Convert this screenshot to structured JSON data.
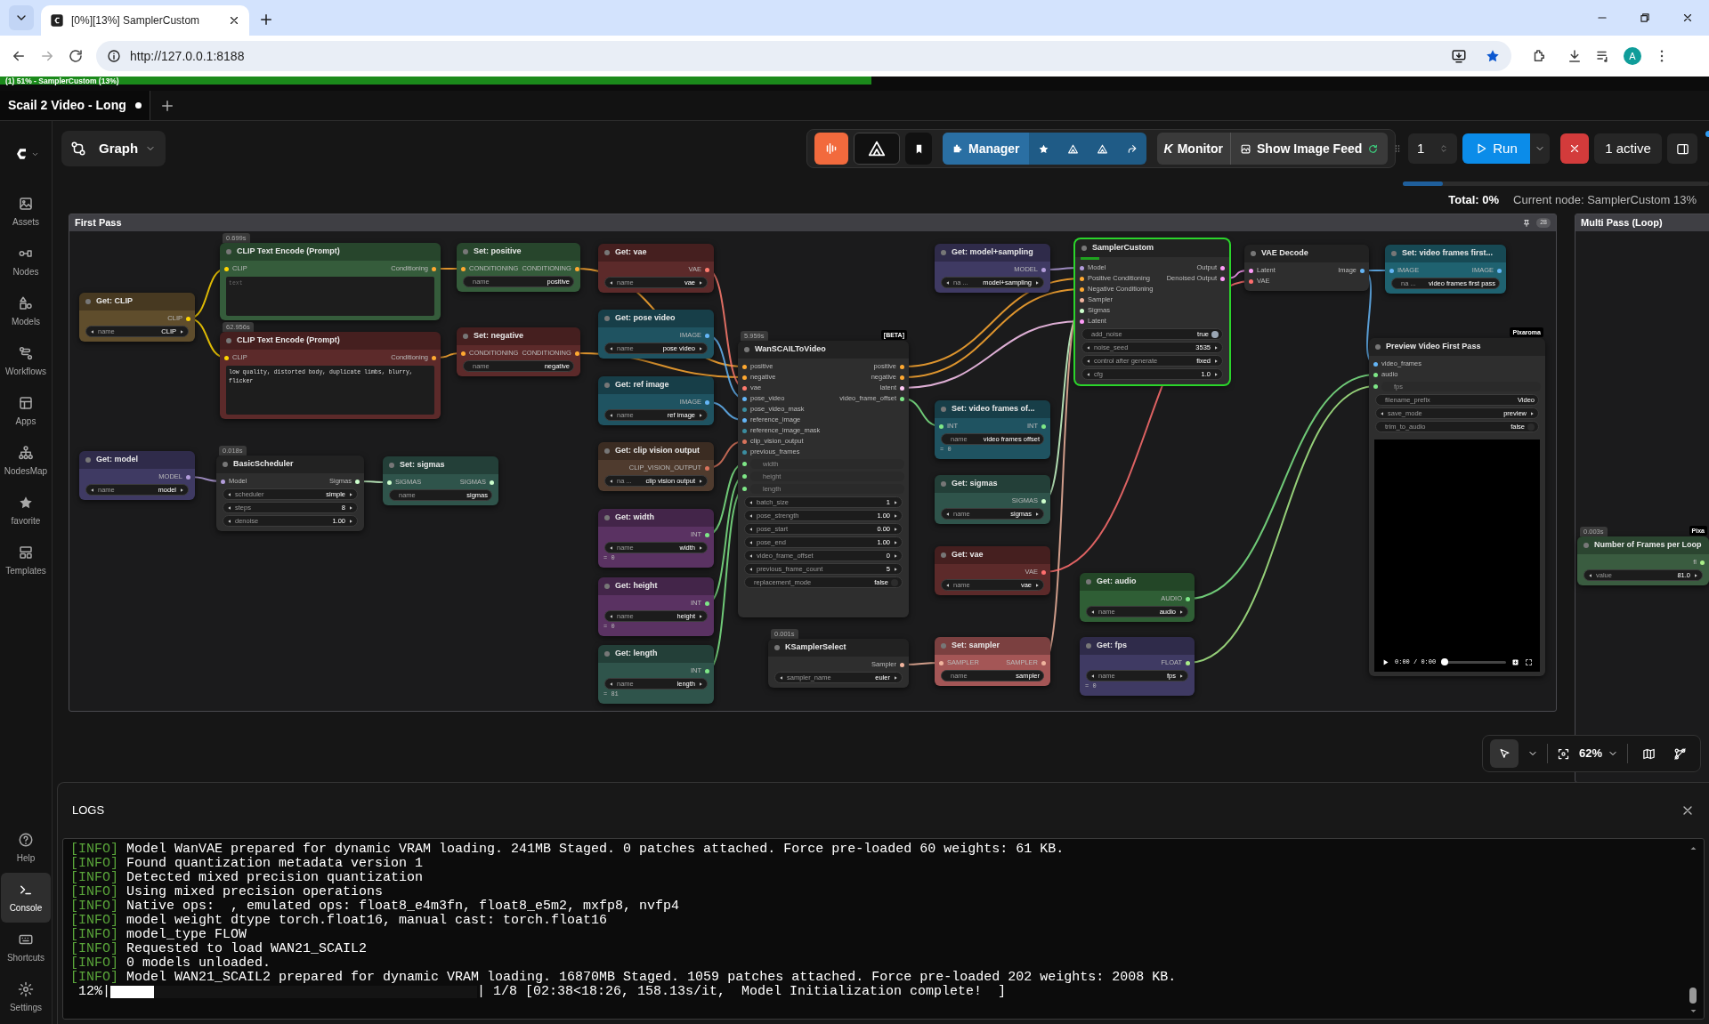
{
  "browser": {
    "tabs": [
      {
        "title": "[0%][13%] SamplerCustom",
        "selected": true
      }
    ],
    "url": "http://127.0.0.1:8188",
    "profile_initial": "A"
  },
  "progress": {
    "text": "(1) 51% - SamplerCustom (13%)",
    "level": 0.51
  },
  "workflow_tabs": [
    {
      "label": "Scail 2 Video - Long",
      "selected": true,
      "unsaved": true
    }
  ],
  "sidebar": {
    "top": [
      {
        "label": "Assets",
        "selected": false
      },
      {
        "label": "Nodes",
        "selected": false
      },
      {
        "label": "Models",
        "selected": false
      },
      {
        "label": "Workflows",
        "selected": false
      },
      {
        "label": "Apps",
        "selected": false
      },
      {
        "label": "NodesMap",
        "selected": false
      },
      {
        "label": "favorite",
        "selected": false
      },
      {
        "label": "Templates",
        "selected": false
      }
    ],
    "bottom": [
      {
        "label": "Help",
        "selected": false
      },
      {
        "label": "Console",
        "selected": true
      },
      {
        "label": "Shortcuts",
        "selected": false
      },
      {
        "label": "Settings",
        "selected": false
      }
    ]
  },
  "toolbar": {
    "graph": "Graph",
    "manager": "Manager",
    "monitor_logo": "K",
    "monitor": "Monitor",
    "image_feed": "Show Image Feed",
    "batch_count": "1",
    "run": "Run",
    "queue": "1 active"
  },
  "status": {
    "total": "Total: 0%",
    "current_node": "Current node: SamplerCustom 13%",
    "level": 0.13
  },
  "groups": [
    {
      "title": "First Pass",
      "badge": "28"
    },
    {
      "title": "Multi Pass (Loop)"
    }
  ],
  "nodes": [
    {
      "title": "Get: CLIP",
      "color": "#5f4d2c",
      "executing": false,
      "outputs": [
        {
          "label": "CLIP",
          "color": "#ffd500"
        }
      ],
      "widgets": [
        {
          "kind": "combo",
          "label": "name",
          "value": "CLIP"
        }
      ]
    },
    {
      "title": "CLIP Text Encode (Prompt)",
      "color": "#355c3b",
      "executing": false,
      "timing": "0.699s",
      "inputs": [
        {
          "label": "CLIP",
          "color": "#ffd500"
        }
      ],
      "outputs": [
        {
          "label": "Conditioning",
          "color": "#ffa931"
        }
      ],
      "prompt": {
        "placeholder": "text"
      }
    },
    {
      "title": "CLIP Text Encode (Prompt)",
      "color": "#5c2a2a",
      "executing": false,
      "timing": "62.956s",
      "inputs": [
        {
          "label": "CLIP",
          "color": "#ffd500"
        }
      ],
      "outputs": [
        {
          "label": "Conditioning",
          "color": "#ffa931"
        }
      ],
      "prompt": {
        "value": "low quality, distorted body, duplicate limbs, blurry, flicker"
      }
    },
    {
      "title": "Set: positive",
      "color": "#355c3b",
      "executing": false,
      "inputs": [
        {
          "label": "CONDITIONING",
          "color": "#ffa931"
        }
      ],
      "outputs": [
        {
          "label": "CONDITIONING",
          "color": "#ffa931"
        }
      ],
      "widgets": [
        {
          "kind": "text",
          "label": "name",
          "value": "positive"
        }
      ]
    },
    {
      "title": "Set: negative",
      "color": "#5c2a2a",
      "executing": false,
      "inputs": [
        {
          "label": "CONDITIONING",
          "color": "#ffa931"
        }
      ],
      "outputs": [
        {
          "label": "CONDITIONING",
          "color": "#ffa931"
        }
      ],
      "widgets": [
        {
          "kind": "text",
          "label": "name",
          "value": "negative"
        }
      ]
    },
    {
      "title": "Get: model",
      "color": "#3f3a63",
      "executing": false,
      "outputs": [
        {
          "label": "MODEL",
          "color": "#b39ddb"
        }
      ],
      "widgets": [
        {
          "kind": "combo",
          "label": "name",
          "value": "model"
        }
      ]
    },
    {
      "title": "BasicScheduler",
      "color": "#2e2e2e",
      "executing": false,
      "timing": "0.018s",
      "inputs": [
        {
          "label": "Model",
          "color": "#b39ddb"
        }
      ],
      "outputs": [
        {
          "label": "Sigmas",
          "color": "#cdffcd"
        }
      ],
      "widgets": [
        {
          "kind": "combo",
          "label": "scheduler",
          "value": "simple"
        },
        {
          "kind": "number",
          "label": "steps",
          "value": "8"
        },
        {
          "kind": "number",
          "label": "denoise",
          "value": "1.00"
        }
      ]
    },
    {
      "title": "Set: sigmas",
      "color": "#2f544b",
      "executing": false,
      "inputs": [
        {
          "label": "SIGMAS",
          "color": "#cdffcd"
        }
      ],
      "outputs": [
        {
          "label": "SIGMAS",
          "color": "#cdffcd"
        }
      ],
      "widgets": [
        {
          "kind": "text",
          "label": "name",
          "value": "sigmas"
        }
      ]
    },
    {
      "title": "Get: vae",
      "color": "#5c2a2a",
      "executing": false,
      "outputs": [
        {
          "label": "VAE",
          "color": "#ff7b6e"
        }
      ],
      "widgets": [
        {
          "kind": "combo",
          "label": "name",
          "value": "vae"
        }
      ]
    },
    {
      "title": "Get: pose video",
      "color": "#1f5361",
      "executing": false,
      "outputs": [
        {
          "label": "IMAGE",
          "color": "#64b5f6"
        }
      ],
      "widgets": [
        {
          "kind": "combo",
          "label": "name",
          "value": "pose video"
        }
      ]
    },
    {
      "title": "Get: ref image",
      "color": "#1f5361",
      "executing": false,
      "outputs": [
        {
          "label": "IMAGE",
          "color": "#64b5f6"
        }
      ],
      "widgets": [
        {
          "kind": "combo",
          "label": "name",
          "value": "ref image"
        }
      ]
    },
    {
      "title": "Get: clip vision output",
      "color": "#4f3b2e",
      "executing": false,
      "outputs": [
        {
          "label": "CLIP_VISION_OUTPUT",
          "color": "#d9735c"
        }
      ],
      "widgets": [
        {
          "kind": "combo",
          "label": "na ...",
          "value": "clip vision output"
        }
      ]
    },
    {
      "title": "Get: width",
      "color": "#5a3262",
      "executing": false,
      "outputs": [
        {
          "label": "INT",
          "color": "#7ee787"
        }
      ],
      "widgets": [
        {
          "kind": "combo",
          "label": "name",
          "value": "width"
        }
      ],
      "note": "= 0"
    },
    {
      "title": "Get: height",
      "color": "#5a3262",
      "executing": false,
      "outputs": [
        {
          "label": "INT",
          "color": "#7ee787"
        }
      ],
      "widgets": [
        {
          "kind": "combo",
          "label": "name",
          "value": "height"
        }
      ],
      "note": "= 0"
    },
    {
      "title": "Get: length",
      "color": "#2f544b",
      "executing": false,
      "outputs": [
        {
          "label": "INT",
          "color": "#7ee787"
        }
      ],
      "widgets": [
        {
          "kind": "combo",
          "label": "name",
          "value": "length"
        }
      ],
      "note": "= 81"
    },
    {
      "title": "WanSCAILToVideo",
      "color": "#2e2e2e",
      "executing": false,
      "timing": "5.959s",
      "tag": "[BETA]",
      "inputs": [
        {
          "label": "positive",
          "color": "#ffa931"
        },
        {
          "label": "negative",
          "color": "#ffa931"
        },
        {
          "label": "vae",
          "color": "#ff7b6e"
        },
        {
          "label": "pose_video",
          "color": "#64b5f6"
        },
        {
          "label": "pose_video_mask",
          "color": "#3b8da0"
        },
        {
          "label": "reference_image",
          "color": "#64b5f6"
        },
        {
          "label": "reference_image_mask",
          "color": "#3b8da0"
        },
        {
          "label": "clip_vision_output",
          "color": "#d9735c"
        },
        {
          "label": "previous_frames",
          "color": "#3b8da0"
        },
        {
          "label": "width",
          "color": "#7ee787",
          "kind": "widget"
        },
        {
          "label": "height",
          "color": "#7ee787",
          "kind": "widget"
        },
        {
          "label": "length",
          "color": "#7ee787",
          "kind": "widget"
        }
      ],
      "outputs": [
        {
          "label": "positive",
          "color": "#ffa931"
        },
        {
          "label": "negative",
          "color": "#ffa931"
        },
        {
          "label": "latent",
          "color": "#ffc8f5"
        },
        {
          "label": "video_frame_offset",
          "color": "#7ee787"
        }
      ],
      "widgets": [
        {
          "kind": "number",
          "label": "batch_size",
          "value": "1"
        },
        {
          "kind": "number",
          "label": "pose_strength",
          "value": "1.00"
        },
        {
          "kind": "number",
          "label": "pose_start",
          "value": "0.00"
        },
        {
          "kind": "number",
          "label": "pose_end",
          "value": "1.00"
        },
        {
          "kind": "number",
          "label": "video_frame_offset",
          "value": "0"
        },
        {
          "kind": "number",
          "label": "previous_frame_count",
          "value": "5"
        },
        {
          "kind": "toggle",
          "label": "replacement_mode",
          "value": "false",
          "on": false
        }
      ]
    },
    {
      "title": "KSamplerSelect",
      "color": "#2e2e2e",
      "executing": false,
      "timing": "0.001s",
      "outputs": [
        {
          "label": "Sampler",
          "color": "#f0b49e"
        }
      ],
      "widgets": [
        {
          "kind": "combo",
          "label": "sampler_name",
          "value": "euler"
        }
      ]
    },
    {
      "title": "Get: model+sampling",
      "color": "#3f3a63",
      "executing": false,
      "outputs": [
        {
          "label": "MODEL",
          "color": "#b39ddb"
        }
      ],
      "widgets": [
        {
          "kind": "combo",
          "label": "na ...",
          "value": "model+sampling"
        }
      ]
    },
    {
      "title": "Set: video frames of...",
      "color": "#1f5361",
      "executing": false,
      "inputs": [
        {
          "label": "INT",
          "color": "#7ee787"
        }
      ],
      "outputs": [
        {
          "label": "INT",
          "color": "#7ee787"
        }
      ],
      "widgets": [
        {
          "kind": "text",
          "label": "name",
          "value": "video frames offset"
        }
      ],
      "note": "= 0"
    },
    {
      "title": "Get: sigmas",
      "color": "#2f544b",
      "executing": false,
      "outputs": [
        {
          "label": "SIGMAS",
          "color": "#cdffcd"
        }
      ],
      "widgets": [
        {
          "kind": "combo",
          "label": "name",
          "value": "sigmas"
        }
      ]
    },
    {
      "title": "Get: vae",
      "color": "#5c2a2a",
      "executing": false,
      "outputs": [
        {
          "label": "VAE",
          "color": "#ff6e6e"
        }
      ],
      "widgets": [
        {
          "kind": "combo",
          "label": "name",
          "value": "vae"
        }
      ]
    },
    {
      "title": "Set: sampler",
      "color": "#a45656",
      "executing": false,
      "inputs": [
        {
          "label": "SAMPLER",
          "color": "#f0b49e"
        }
      ],
      "outputs": [
        {
          "label": "SAMPLER",
          "color": "#f0b49e"
        }
      ],
      "widgets": [
        {
          "kind": "text",
          "label": "name",
          "value": "sampler"
        }
      ]
    },
    {
      "title": "SamplerCustom",
      "color": "#2e2e2e",
      "executing": true,
      "level": 0.13,
      "inputs": [
        {
          "label": "Model",
          "color": "#b39ddb"
        },
        {
          "label": "Positive Conditioning",
          "color": "#ffa931"
        },
        {
          "label": "Negative Conditioning",
          "color": "#ffa931"
        },
        {
          "label": "Sampler",
          "color": "#f0b49e"
        },
        {
          "label": "Sigmas",
          "color": "#cdffcd"
        },
        {
          "label": "Latent",
          "color": "#ff9cf9"
        }
      ],
      "outputs": [
        {
          "label": "Output",
          "color": "#ff9cf9"
        },
        {
          "label": "Denoised Output",
          "color": "#ff9cf9"
        }
      ],
      "widgets": [
        {
          "kind": "toggle",
          "label": "add_noise",
          "value": "true",
          "on": true
        },
        {
          "kind": "number",
          "label": "noise_seed",
          "value": "3535"
        },
        {
          "kind": "combo",
          "label": "control after generate",
          "value": "fixed"
        },
        {
          "kind": "number",
          "label": "cfg",
          "value": "1.0"
        }
      ]
    },
    {
      "title": "VAE Decode",
      "color": "#2e2e2e",
      "executing": false,
      "inputs": [
        {
          "label": "Latent",
          "color": "#ff9cf9"
        },
        {
          "label": "VAE",
          "color": "#ff6e6e"
        }
      ],
      "outputs": [
        {
          "label": "Image",
          "color": "#64b5f6"
        }
      ]
    },
    {
      "title": "Set: video frames first...",
      "color": "#1f6270",
      "executing": false,
      "inputs": [
        {
          "label": "IMAGE",
          "color": "#64b5f6"
        }
      ],
      "outputs": [
        {
          "label": "IMAGE",
          "color": "#64b5f6"
        }
      ],
      "widgets": [
        {
          "kind": "text",
          "label": "na ...",
          "value": "video frames first pass"
        }
      ]
    },
    {
      "title": "Preview Video First Pass",
      "color": "#2e2e2e",
      "executing": false,
      "tag": "Pixaroma",
      "inputs": [
        {
          "label": "video_frames",
          "color": "#64b5f6"
        },
        {
          "label": "audio",
          "color": "#7ee787"
        },
        {
          "label": "fps",
          "color": "#7ee787",
          "kind": "widget"
        }
      ],
      "widgets": [
        {
          "kind": "text",
          "label": "filename_prefix",
          "value": "Video"
        },
        {
          "kind": "combo",
          "label": "save_mode",
          "value": "preview"
        },
        {
          "kind": "toggle",
          "label": "trim_to_audio",
          "value": "false",
          "on": false
        }
      ],
      "video": {
        "time": "0:00 / 0:00",
        "level": 0
      }
    },
    {
      "title": "Get: audio",
      "color": "#2f5e35",
      "executing": false,
      "outputs": [
        {
          "label": "AUDIO",
          "color": "#7ee787"
        }
      ],
      "widgets": [
        {
          "kind": "combo",
          "label": "name",
          "value": "audio"
        }
      ]
    },
    {
      "title": "Get: fps",
      "color": "#3f3a63",
      "executing": false,
      "outputs": [
        {
          "label": "FLOAT",
          "color": "#aaee88"
        }
      ],
      "widgets": [
        {
          "kind": "combo",
          "label": "name",
          "value": "fps"
        }
      ],
      "note": "= 0"
    },
    {
      "title": "Number of Frames per Loop",
      "color": "#3a5c40",
      "executing": false,
      "timing": "0.003s",
      "tag": "Pixa",
      "outputs": [
        {
          "label": "fl",
          "color": "#aaee88"
        }
      ],
      "widgets": [
        {
          "kind": "number",
          "label": "value",
          "value": "81.0"
        }
      ]
    }
  ],
  "canvas_toolbar": {
    "zoom": "62%"
  },
  "logs": {
    "title": "LOGS",
    "lines": [
      {
        "tag": "[INFO]",
        "text": "Model WanVAE prepared for dynamic VRAM loading. 241MB Staged. 0 patches attached. Force pre-loaded 60 weights: 61 KB."
      },
      {
        "tag": "[INFO]",
        "text": "Found quantization metadata version 1"
      },
      {
        "tag": "[INFO]",
        "text": "Detected mixed precision quantization"
      },
      {
        "tag": "[INFO]",
        "text": "Using mixed precision operations"
      },
      {
        "tag": "[INFO]",
        "text": "Native ops:  , emulated ops: float8_e4m3fn, float8_e5m2, mxfp8, nvfp4"
      },
      {
        "tag": "[INFO]",
        "text": "model weight dtype torch.float16, manual cast: torch.float16"
      },
      {
        "tag": "[INFO]",
        "text": "model_type FLOW"
      },
      {
        "tag": "[INFO]",
        "text": "Requested to load WAN21_SCAIL2"
      },
      {
        "tag": "[INFO]",
        "text": "0 models unloaded."
      },
      {
        "tag": "[INFO]",
        "text": "Model WAN21_SCAIL2 prepared for dynamic VRAM loading. 16870MB Staged. 1059 patches attached. Force pre-loaded 202 weights: 2008 KB."
      }
    ],
    "progress": {
      "percent": "12%|",
      "level": 0.12,
      "rest": "| 1/8 [02:38<18:26, 158.13s/it,  Model Initialization complete!  ]"
    }
  }
}
